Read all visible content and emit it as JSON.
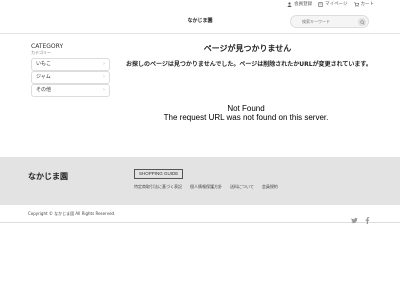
{
  "top_links": {
    "register": "会員登録",
    "mypage": "マイページ",
    "cart": "カート"
  },
  "header": {
    "logo": "なかじま園",
    "search_placeholder": "検索キーワード"
  },
  "sidebar": {
    "title": "CATEGORY",
    "subtitle": "カテゴリー",
    "items": [
      {
        "label": "いもこ"
      },
      {
        "label": "ジャム"
      },
      {
        "label": "その他"
      }
    ]
  },
  "main": {
    "title": "ページが見つかりません",
    "message": "お探しのページは見つかりませんでした。ページは削除されたかURLが変更されています。",
    "error_title": "Not Found",
    "error_detail": "The request URL was not found on this server."
  },
  "footer": {
    "brand": "なかじま園",
    "guide_label": "SHOPPING GUIDE",
    "links": [
      "特定商取引法に基づく表記",
      "個人情報保護方針",
      "送料について",
      "会員規約"
    ],
    "copyright": "Copyright © なかじま園 All Rights Reserved."
  },
  "icons": {
    "user": "user-icon",
    "mypage": "mypage-icon",
    "cart": "cart-icon",
    "search": "search-icon",
    "twitter": "twitter-icon",
    "facebook": "facebook-icon"
  },
  "colors": {
    "footer_bg": "#e3e3e3",
    "icon_gray": "#9a9a9a"
  }
}
